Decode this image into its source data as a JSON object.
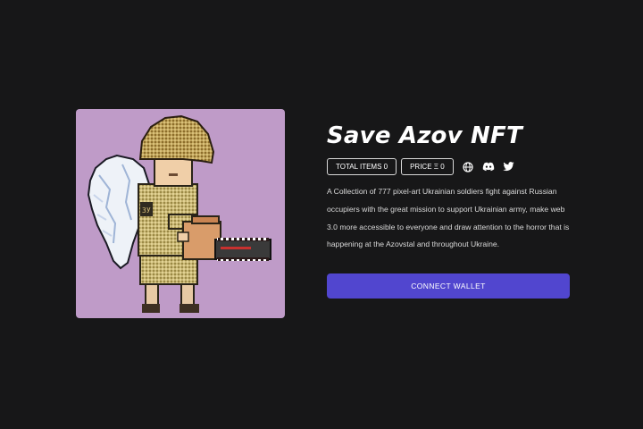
{
  "collection": {
    "title": "Save Azov NFT",
    "total_items": "TOTAL ITEMS 0",
    "price": "PRICE Ξ 0",
    "description": "A Collection of 777 pixel-art Ukrainian soldiers fight against Russian occupiers with the great mission to support Ukrainian army, make web 3.0 more accessible to everyone and draw attention to the horror that is happening at the Azovstal and throughout Ukraine.",
    "connect_label": "CONNECT WALLET"
  },
  "social": [
    "globe-icon",
    "discord-icon",
    "twitter-icon"
  ],
  "colors": {
    "background": "#171718",
    "card_background": "#bf9bc8",
    "button": "#5146cf",
    "text": "#ffffff"
  }
}
